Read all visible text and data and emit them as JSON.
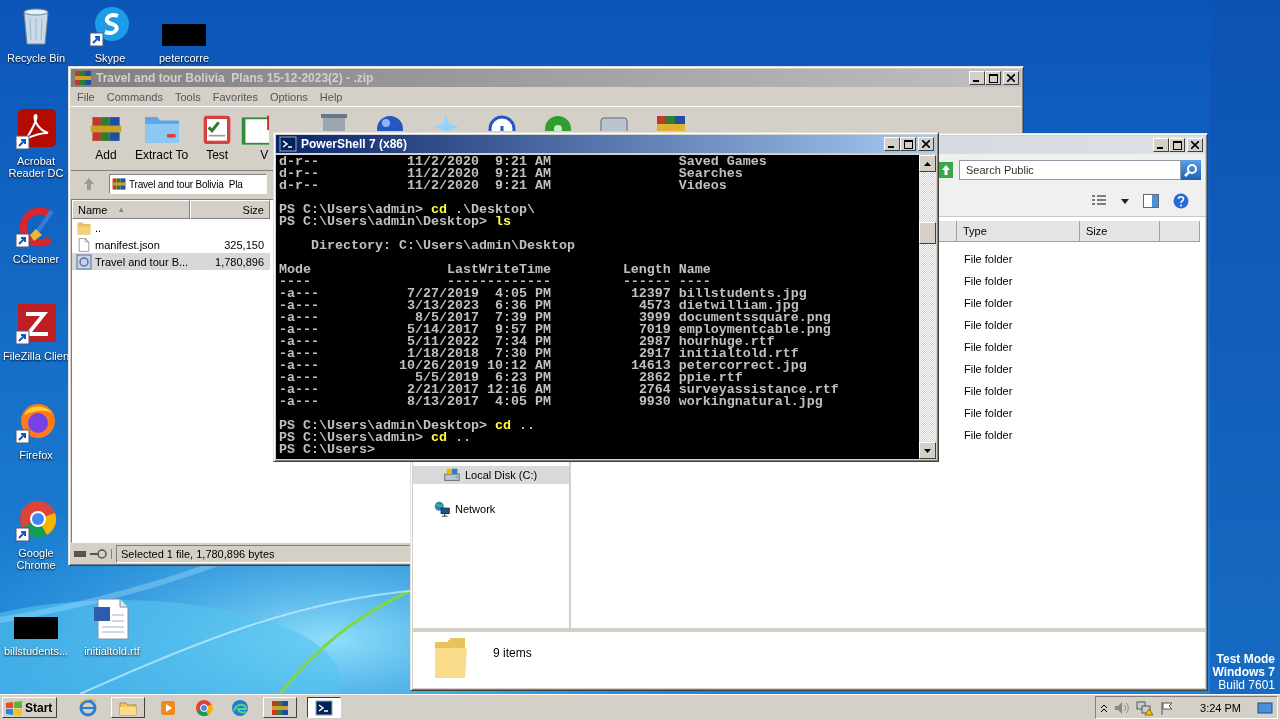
{
  "desktop": {
    "icons": [
      {
        "label": "Recycle Bin",
        "kind": "recycle",
        "shortcut": false
      },
      {
        "label": "Skype",
        "kind": "chat",
        "shortcut": true
      },
      {
        "label": "petercorre",
        "kind": "thumb",
        "shortcut": false
      },
      {
        "label": "Acrobat Reader DC",
        "kind": "pdf",
        "shortcut": true
      },
      {
        "label": "CCleaner",
        "kind": "cleaner",
        "shortcut": true
      },
      {
        "label": "FileZilla Clien",
        "kind": "ftp",
        "shortcut": true
      },
      {
        "label": "Firefox",
        "kind": "firefox",
        "shortcut": true
      },
      {
        "label": "Google Chrome",
        "kind": "chrome",
        "shortcut": true
      },
      {
        "label": "billstudents...",
        "kind": "thumb",
        "shortcut": false
      },
      {
        "label": "initialtold.rtf",
        "kind": "doc",
        "shortcut": false
      }
    ],
    "os_notice": [
      {
        "text": "Test Mode",
        "kind": "heading"
      },
      {
        "text": "Windows 7",
        "kind": "heading"
      },
      {
        "text": "Build 7601",
        "kind": "detail"
      }
    ]
  },
  "archive_window": {
    "title": "Travel and tour Bolivia  Plans 15-12-2023(2) - .zip",
    "active": false,
    "menu": [
      "File",
      "Commands",
      "Tools",
      "Favorites",
      "Options",
      "Help"
    ],
    "toolbar": [
      {
        "label": "Add",
        "kind": "add"
      },
      {
        "label": "Extract To",
        "kind": "extract"
      },
      {
        "label": "Test",
        "kind": "test"
      },
      {
        "label": "V",
        "kind": "view"
      }
    ],
    "address": "Travel and tour Bolivia  Pla",
    "columns": [
      {
        "label": "Name",
        "sort_marker": "▲"
      },
      {
        "label": "Size"
      }
    ],
    "rows": [
      {
        "name": "..",
        "kind": "folder",
        "selected": false
      },
      {
        "name": "manifest.json",
        "size": "325,150",
        "kind": "file",
        "selected": false
      },
      {
        "name": "Travel and tour B...",
        "size": "1,780,896",
        "kind": "archive",
        "selected": true
      }
    ],
    "status": "Selected 1 file, 1,780,896 bytes"
  },
  "explorer_window": {
    "active": false,
    "search": {
      "placeholder": "Search Public"
    },
    "columns": [
      "Type",
      "Size"
    ],
    "rows": [
      {
        "type": "File folder"
      },
      {
        "type": "File folder"
      },
      {
        "type": "File folder"
      },
      {
        "type": "File folder"
      },
      {
        "type": "File folder"
      },
      {
        "type": "File folder"
      },
      {
        "type": "File folder"
      },
      {
        "type": "File folder"
      },
      {
        "type": "File folder"
      }
    ],
    "nav": [
      {
        "label": "Local Disk (C:)",
        "kind": "drive",
        "selected": true
      },
      {
        "label": "Network",
        "kind": "network",
        "selected": false
      }
    ],
    "details": "9 items"
  },
  "terminal_window": {
    "title": "PowerShell 7 (x86)",
    "active": true,
    "lines": [
      {
        "kind": "entry",
        "mode": "d-r--",
        "date": "11/2/2020",
        "time": "9:21 AM",
        "name": "Saved Games"
      },
      {
        "kind": "entry",
        "mode": "d-r--",
        "date": "11/2/2020",
        "time": "9:21 AM",
        "name": "Searches"
      },
      {
        "kind": "entry",
        "mode": "d-r--",
        "date": "11/2/2020",
        "time": "9:21 AM",
        "name": "Videos"
      },
      {
        "kind": "blank"
      },
      {
        "kind": "prompt",
        "prompt": "PS C:\\Users\\admin>",
        "command": "cd",
        "args": ".\\Desktop\\"
      },
      {
        "kind": "prompt",
        "prompt": "PS C:\\Users\\admin\\Desktop>",
        "command": "ls"
      },
      {
        "kind": "blank"
      },
      {
        "kind": "directory",
        "text": "Directory: C:\\Users\\admin\\Desktop"
      },
      {
        "kind": "blank"
      },
      {
        "kind": "header",
        "mode": "Mode",
        "date": "LastWriteTime",
        "length": "Length",
        "name": "Name"
      },
      {
        "kind": "header",
        "mode": "----",
        "date": "-------------",
        "length": "------",
        "name": "----"
      },
      {
        "kind": "entry",
        "mode": "-a---",
        "date": "7/27/2019",
        "time": "4:05 PM",
        "length": "12397",
        "name": "billstudents.jpg"
      },
      {
        "kind": "entry",
        "mode": "-a---",
        "date": "3/13/2023",
        "time": "6:36 PM",
        "length": "4573",
        "name": "dietwilliam.jpg"
      },
      {
        "kind": "entry",
        "mode": "-a---",
        "date": "8/5/2017",
        "time": "7:39 PM",
        "length": "3999",
        "name": "documentssquare.png"
      },
      {
        "kind": "entry",
        "mode": "-a---",
        "date": "5/14/2017",
        "time": "9:57 PM",
        "length": "7019",
        "name": "employmentcable.png"
      },
      {
        "kind": "entry",
        "mode": "-a---",
        "date": "5/11/2022",
        "time": "7:34 PM",
        "length": "2987",
        "name": "hourhuge.rtf"
      },
      {
        "kind": "entry",
        "mode": "-a---",
        "date": "1/18/2018",
        "time": "7:30 PM",
        "length": "2917",
        "name": "initialtold.rtf"
      },
      {
        "kind": "entry",
        "mode": "-a---",
        "date": "10/26/2019",
        "time": "10:12 AM",
        "length": "14613",
        "name": "petercorrect.jpg"
      },
      {
        "kind": "entry",
        "mode": "-a---",
        "date": "5/5/2019",
        "time": "6:23 PM",
        "length": "2862",
        "name": "ppie.rtf"
      },
      {
        "kind": "entry",
        "mode": "-a---",
        "date": "2/21/2017",
        "time": "12:16 AM",
        "length": "2764",
        "name": "surveyassistance.rtf"
      },
      {
        "kind": "entry",
        "mode": "-a---",
        "date": "8/13/2017",
        "time": "4:05 PM",
        "length": "9930",
        "name": "workingnatural.jpg"
      },
      {
        "kind": "blank"
      },
      {
        "kind": "prompt",
        "prompt": "PS C:\\Users\\admin\\Desktop>",
        "command": "cd",
        "args": ".."
      },
      {
        "kind": "prompt",
        "prompt": "PS C:\\Users\\admin>",
        "command": "cd",
        "args": ".."
      },
      {
        "kind": "prompt",
        "prompt": "PS C:\\Users>"
      }
    ]
  },
  "taskbar": {
    "start": "Start",
    "items": [
      {
        "kind": "ie",
        "open": false,
        "selected": false
      },
      {
        "kind": "explorer",
        "open": true,
        "selected": false
      },
      {
        "kind": "media",
        "open": false,
        "selected": false
      },
      {
        "kind": "chrome",
        "open": false,
        "selected": false
      },
      {
        "kind": "edge",
        "open": false,
        "selected": false
      },
      {
        "kind": "archive",
        "open": true,
        "selected": false
      },
      {
        "kind": "terminal",
        "open": true,
        "selected": true
      }
    ],
    "clock": "3:24 PM"
  }
}
